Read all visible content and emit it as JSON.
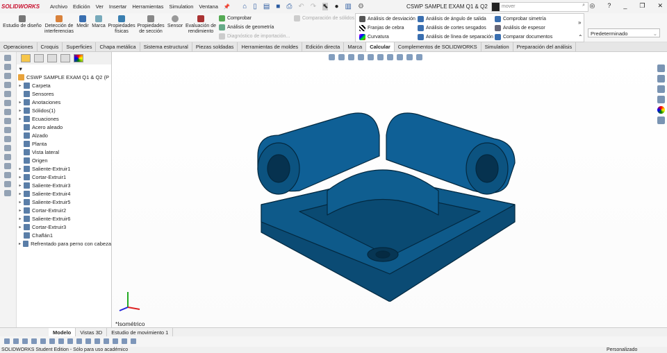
{
  "app": {
    "logo": "SOLIDWORKS",
    "doc_title": "CSWP SAMPLE EXAM Q1 & Q2"
  },
  "menu": [
    "Archivo",
    "Edición",
    "Ver",
    "Insertar",
    "Herramientas",
    "Simulation",
    "Ventana"
  ],
  "search": {
    "value": "mover"
  },
  "ribbon": {
    "big": [
      {
        "label": "Estudio de diseño"
      },
      {
        "label": "Detección de interferencias"
      },
      {
        "label": "Medir"
      },
      {
        "label": "Marca"
      },
      {
        "label": "Propiedades físicas"
      },
      {
        "label": "Propiedades de sección"
      },
      {
        "label": "Sensor"
      },
      {
        "label": "Evaluación de rendimiento"
      }
    ],
    "small": [
      "Comprobar",
      "Análisis de geometría",
      "Diagnóstico de importación...",
      "Comparación de sólidos"
    ],
    "flyout": [
      "Análisis de desviación",
      "Franjas de cebra",
      "Curvatura",
      "Análisis de ángulo de salida",
      "Análisis de cortes sesgados",
      "Análisis de línea de separación",
      "Comprobar simetría",
      "Análisis de espesor",
      "Comparar documentos"
    ],
    "config": "Predeterminado"
  },
  "tabs": [
    "Operaciones",
    "Croquis",
    "Superficies",
    "Chapa metálica",
    "Sistema estructural",
    "Piezas soldadas",
    "Herramientas de moldes",
    "Edición directa",
    "Marca",
    "Calcular",
    "Complementos de SOLIDWORKS",
    "Simulation",
    "Preparación del análisis"
  ],
  "active_tab": "Calcular",
  "tree": {
    "root": "CSWP SAMPLE EXAM Q1 & Q2 (P",
    "items": [
      "Carpeta",
      "Sensores",
      "Anotaciones",
      "Sólidos(1)",
      "Ecuaciones",
      "Acero aleado",
      "Alzado",
      "Planta",
      "Vista lateral",
      "Origen",
      "Saliente-Extruir1",
      "Cortar-Extruir1",
      "Saliente-Extruir3",
      "Saliente-Extruir4",
      "Saliente-Extruir5",
      "Cortar-Extruir2",
      "Saliente-Extruir6",
      "Cortar-Extruir3",
      "Chaflán1",
      "Refrentado para perno con cabeza"
    ]
  },
  "view": {
    "label": "*Isométrico",
    "model_color": "#0e5a8a"
  },
  "bottom_tabs": [
    "Modelo",
    "Vistas 3D",
    "Estudio de movimiento 1"
  ],
  "status": {
    "left": "SOLIDWORKS Student Edition - Sólo para uso académico",
    "right": "Personalizado"
  }
}
